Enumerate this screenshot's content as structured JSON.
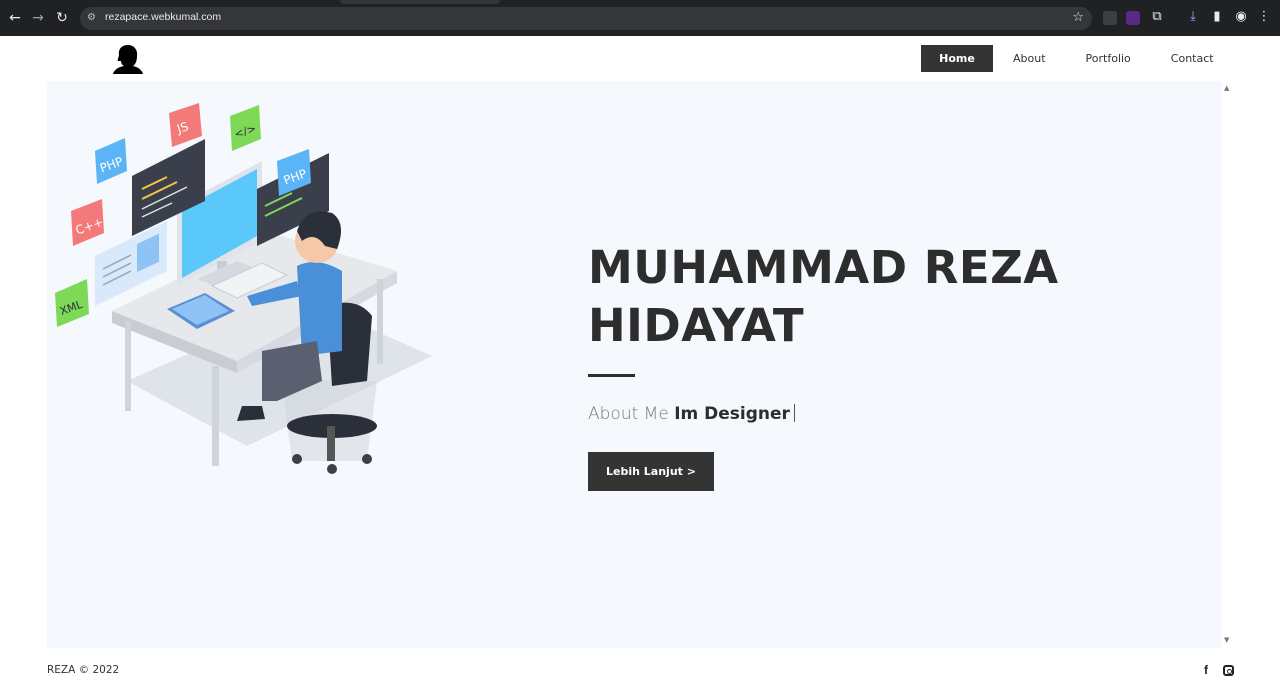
{
  "browser": {
    "url": "rezapace.webkumal.com"
  },
  "nav": {
    "items": [
      {
        "label": "Home",
        "active": true
      },
      {
        "label": "About",
        "active": false
      },
      {
        "label": "Portfolio",
        "active": false
      },
      {
        "label": "Contact",
        "active": false
      }
    ]
  },
  "hero": {
    "title_line1": "MUHAMMAD REZA",
    "title_line2": "HIDAYAT",
    "sub_prefix": "About Me",
    "sub_role": "Im Designer",
    "cta_label": "Lebih Lanjut >",
    "badges": [
      "PHP",
      "JS",
      "</>",
      "C++",
      "XML",
      "PHP"
    ]
  },
  "footer": {
    "copyright": "REZA © 2022"
  },
  "colors": {
    "accent_dark": "#343434",
    "hero_bg": "#f5f9fd"
  }
}
